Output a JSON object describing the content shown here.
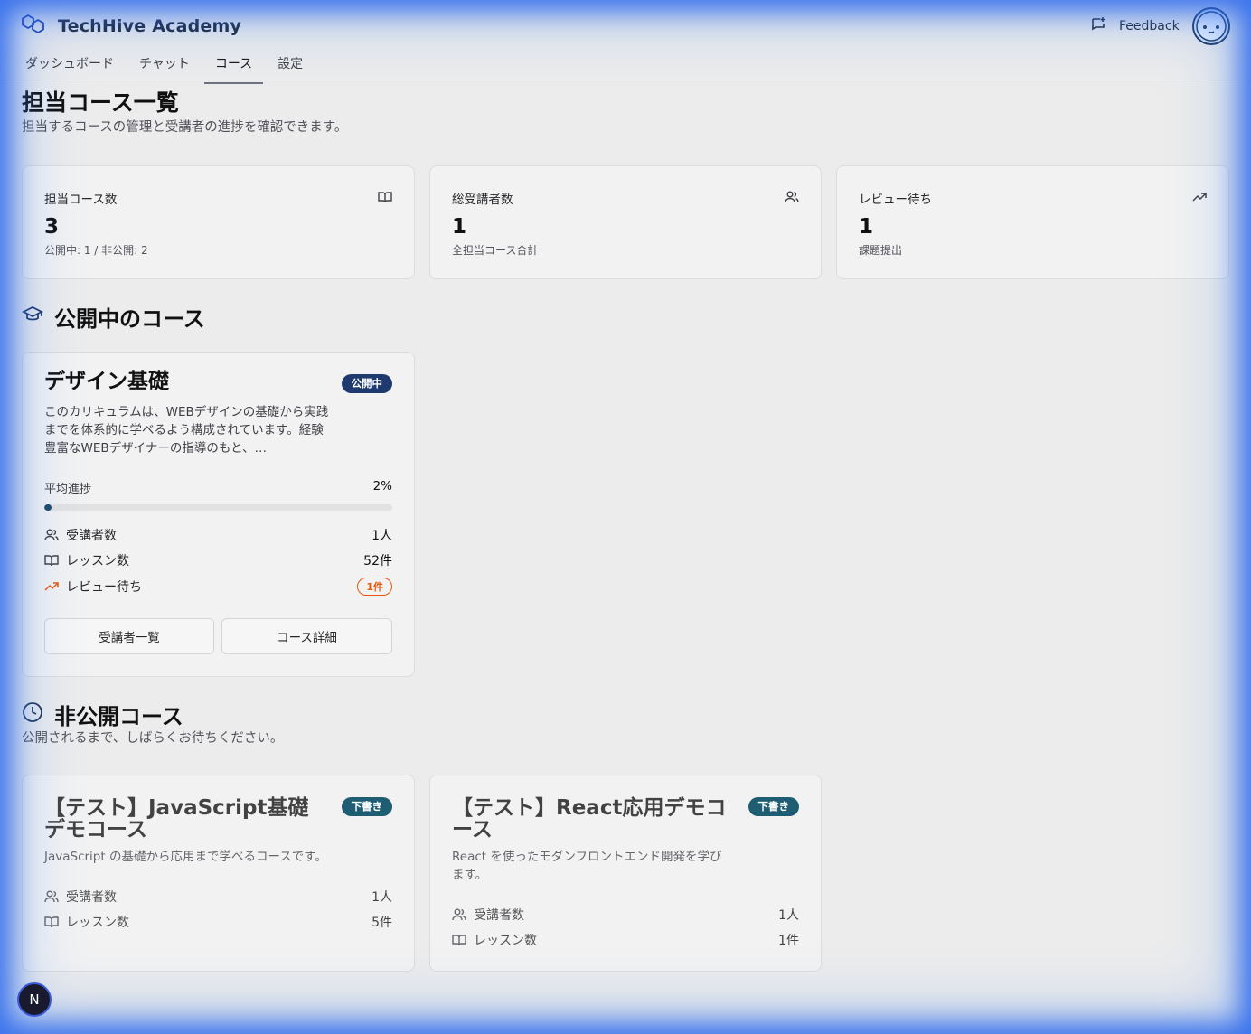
{
  "app": {
    "title": "TechHive Academy",
    "feedback_label": "Feedback"
  },
  "tabs": [
    {
      "label": "ダッシュボード",
      "active": false
    },
    {
      "label": "チャット",
      "active": false
    },
    {
      "label": "コース",
      "active": true
    },
    {
      "label": "設定",
      "active": false
    }
  ],
  "page": {
    "title": "担当コース一覧",
    "subtitle": "担当するコースの管理と受講者の進捗を確認できます。"
  },
  "stats": [
    {
      "label": "担当コース数",
      "value": "3",
      "note": "公開中: 1 / 非公開: 2",
      "icon": "book-open-icon"
    },
    {
      "label": "総受講者数",
      "value": "1",
      "note": "全担当コース合計",
      "icon": "users-icon"
    },
    {
      "label": "レビュー待ち",
      "value": "1",
      "note": "課題提出",
      "icon": "trending-up-icon"
    }
  ],
  "published": {
    "heading": "公開中のコース",
    "course": {
      "title": "デザイン基礎",
      "badge": "公開中",
      "desc": "このカリキュラムは、WEBデザインの基礎から実践までを体系的に学べるよう構成されています。経験豊富なWEBデザイナーの指導のもと、…",
      "progress_label": "平均進捗",
      "progress_text": "2%",
      "progress_pct": 2,
      "students_label": "受講者数",
      "students": "1人",
      "lessons_label": "レッスン数",
      "lessons": "52件",
      "review_label": "レビュー待ち",
      "review": "1件",
      "btn_students": "受講者一覧",
      "btn_detail": "コース詳細"
    }
  },
  "unpublished": {
    "heading": "非公開コース",
    "subtitle": "公開されるまで、しばらくお待ちください。",
    "courses": [
      {
        "title": "【テスト】JavaScript基礎デモコース",
        "badge": "下書き",
        "desc": "JavaScript の基礎から応用まで学べるコースです。",
        "students_label": "受講者数",
        "students": "1人",
        "lessons_label": "レッスン数",
        "lessons": "5件"
      },
      {
        "title": "【テスト】React応用デモコース",
        "badge": "下書き",
        "desc": "React を使ったモダンフロントエンド開発を学びます。",
        "students_label": "受講者数",
        "students": "1人",
        "lessons_label": "レッスン数",
        "lessons": "1件"
      }
    ]
  },
  "dev_badge": "N",
  "colors": {
    "brand": "#1e3a6e",
    "draft": "#1f5d73",
    "warning": "#ea580c",
    "progress": "#1f4a6b"
  }
}
